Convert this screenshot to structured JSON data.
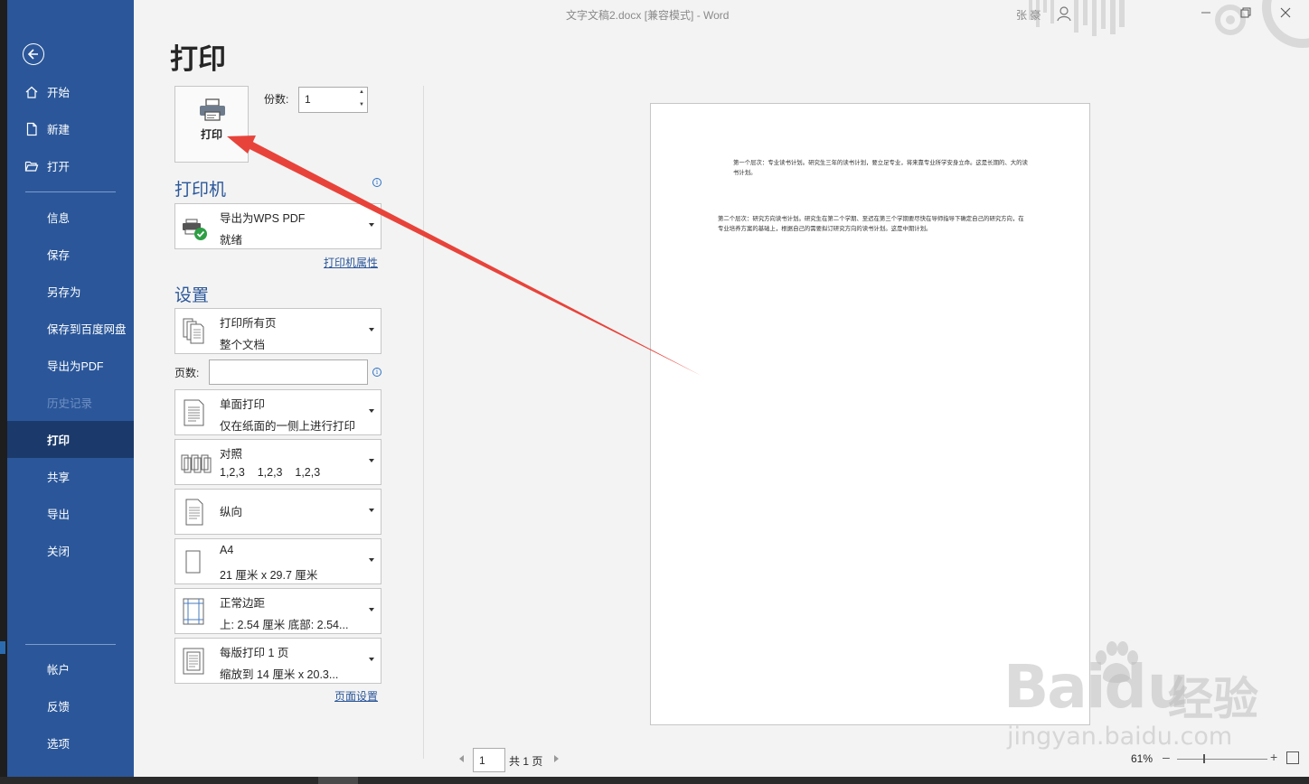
{
  "window": {
    "title": "文字文稿2.docx [兼容模式] - Word",
    "user": "张 豪"
  },
  "sidebar": {
    "items": [
      {
        "label": "开始",
        "icon": "home-icon"
      },
      {
        "label": "新建",
        "icon": "new-doc-icon"
      },
      {
        "label": "打开",
        "icon": "folder-open-icon"
      },
      {
        "label": "信息"
      },
      {
        "label": "保存"
      },
      {
        "label": "另存为"
      },
      {
        "label": "保存到百度网盘"
      },
      {
        "label": "导出为PDF"
      },
      {
        "label": "历史记录",
        "disabled": true
      },
      {
        "label": "打印",
        "active": true
      },
      {
        "label": "共享"
      },
      {
        "label": "导出"
      },
      {
        "label": "关闭"
      },
      {
        "label": "帐户"
      },
      {
        "label": "反馈"
      },
      {
        "label": "选项"
      }
    ]
  },
  "print": {
    "heading": "打印",
    "button_label": "打印",
    "copies_label": "份数:",
    "copies_value": "1",
    "printer_section": "打印机",
    "printer_name": "导出为WPS PDF",
    "printer_status": "就绪",
    "printer_props_link": "打印机属性",
    "settings_section": "设置",
    "pages_label": "页数:",
    "pages_value": "",
    "page_setup_link": "页面设置",
    "settings": [
      {
        "line1": "打印所有页",
        "line2": "整个文档",
        "icon": "all-pages-icon"
      },
      {
        "line1": "单面打印",
        "line2": "仅在纸面的一侧上进行打印",
        "icon": "one-sided-icon"
      },
      {
        "line1": "对照",
        "line2": "1,2,3    1,2,3    1,2,3",
        "icon": "collated-icon"
      },
      {
        "line1": "纵向",
        "line2": "",
        "icon": "portrait-icon"
      },
      {
        "line1": "A4",
        "line2": "21 厘米 x 29.7 厘米",
        "icon": "paper-size-icon"
      },
      {
        "line1": "正常边距",
        "line2": "上: 2.54 厘米 底部: 2.54...",
        "icon": "margins-icon"
      },
      {
        "line1": "每版打印 1 页",
        "line2": "缩放到 14 厘米 x 20.3...",
        "icon": "pages-per-sheet-icon"
      }
    ]
  },
  "preview": {
    "paragraph1": "第一个层次：专业读书计划。研究生三年的读书计划，要立足专业，将来靠专业所学安身立命。这是长期的、大的读书计划。",
    "paragraph2": "第二个层次：研究方向读书计划。研究生在第二个学期、至迟在第三个学期要尽快在导师指导下确定自己的研究方向，在专业培养方案的基础上，根据自己的需要拟订研究方向的读书计划。这是中期计划。",
    "current_page": "1",
    "total_pages": "共 1 页",
    "zoom": "61%"
  },
  "watermark": {
    "main": "Bai",
    "main2": "du",
    "cn": "经验",
    "url": "jingyan.baidu.com"
  },
  "colors": {
    "sidebar": "#2b579a",
    "sidebar_active": "#1b3a6b",
    "accent": "#2b579a",
    "arrow": "#e8433a"
  }
}
